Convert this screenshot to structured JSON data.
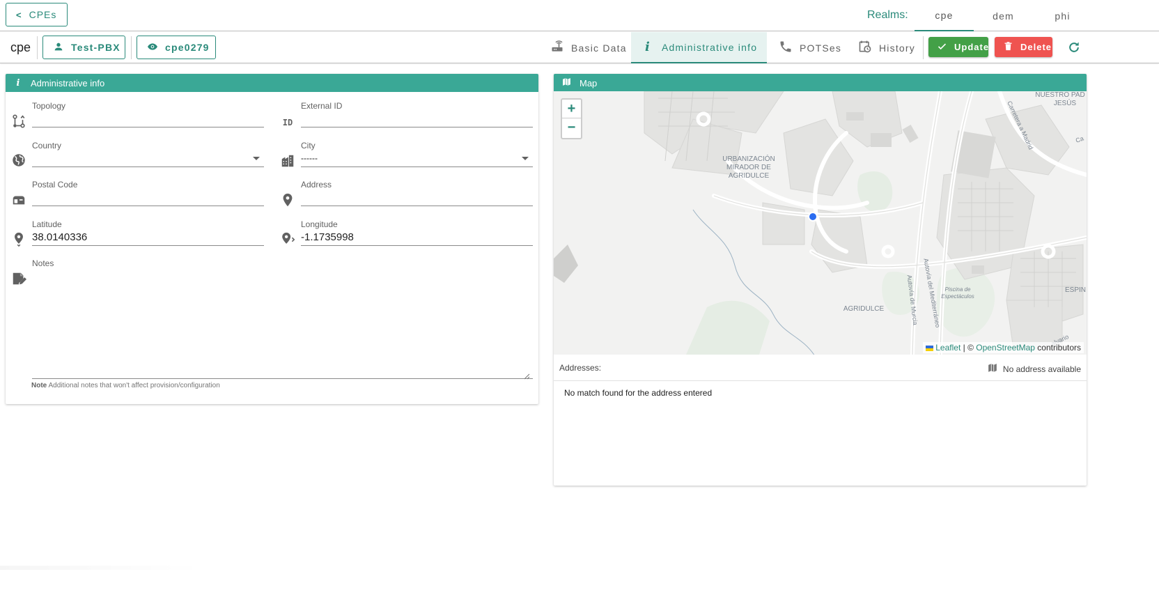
{
  "top": {
    "back_label": "CPEs",
    "realms_label": "Realms:",
    "realms": [
      {
        "label": "cpe",
        "active": true
      },
      {
        "label": "dem",
        "active": false
      },
      {
        "label": "phi",
        "active": false
      }
    ]
  },
  "entity": {
    "type": "cpe",
    "user_button": "Test-PBX",
    "view_button": "cpe0279"
  },
  "tabs": [
    {
      "label": "Basic Data",
      "icon": "router-icon"
    },
    {
      "label": "Administrative info",
      "icon": "info-icon",
      "active": true
    },
    {
      "label": "POTSes",
      "icon": "phone-icon"
    },
    {
      "label": "History",
      "icon": "history-icon"
    }
  ],
  "actions": {
    "update": "Update",
    "delete": "Delete"
  },
  "colors": {
    "accent": "#2a8a7a",
    "header": "#3aa896",
    "update": "#43a047",
    "delete": "#ef5350"
  },
  "admin": {
    "title": "Administrative info",
    "topology": {
      "label": "Topology",
      "value": ""
    },
    "external_id": {
      "label": "External ID",
      "value": "",
      "icon_text": "ID"
    },
    "country": {
      "label": "Country",
      "value": ""
    },
    "city": {
      "label": "City",
      "value": "------"
    },
    "postal_code": {
      "label": "Postal Code",
      "value": ""
    },
    "address": {
      "label": "Address",
      "value": ""
    },
    "latitude": {
      "label": "Latitude",
      "value": "38.0140336"
    },
    "longitude": {
      "label": "Longitude",
      "value": "-1.1735998"
    },
    "notes": {
      "label": "Notes",
      "value": ""
    },
    "note_help_bold": "Note",
    "note_help": " Additional notes that won't affect provision/configuration"
  },
  "map": {
    "title": "Map",
    "labels": {
      "urbanizacion": [
        "URBANIZACIÓN",
        "MIRADOR DE",
        "AGRIDULCE"
      ],
      "agridulce": "AGRIDULCE",
      "nuestro": [
        "NUESTRO PAD",
        "JESÚS"
      ],
      "espin": "ESPIN",
      "piscina": [
        "Piscina de",
        "Espectáculos"
      ],
      "autovia_murcia": "Autovía de Murcia",
      "autovia_med": "Autovía del Mediterráneo",
      "carretera": "Carretera a Madrid",
      "car_edge": "Ca",
      "alvario": "alvario"
    },
    "attrib_leaflet": "Leaflet",
    "attrib_sep": " | © ",
    "attrib_osm": "OpenStreetMap",
    "attrib_contrib": " contributors",
    "addresses_label": "Addresses:",
    "no_address": "No address available",
    "no_match": "No match found for the address entered"
  }
}
